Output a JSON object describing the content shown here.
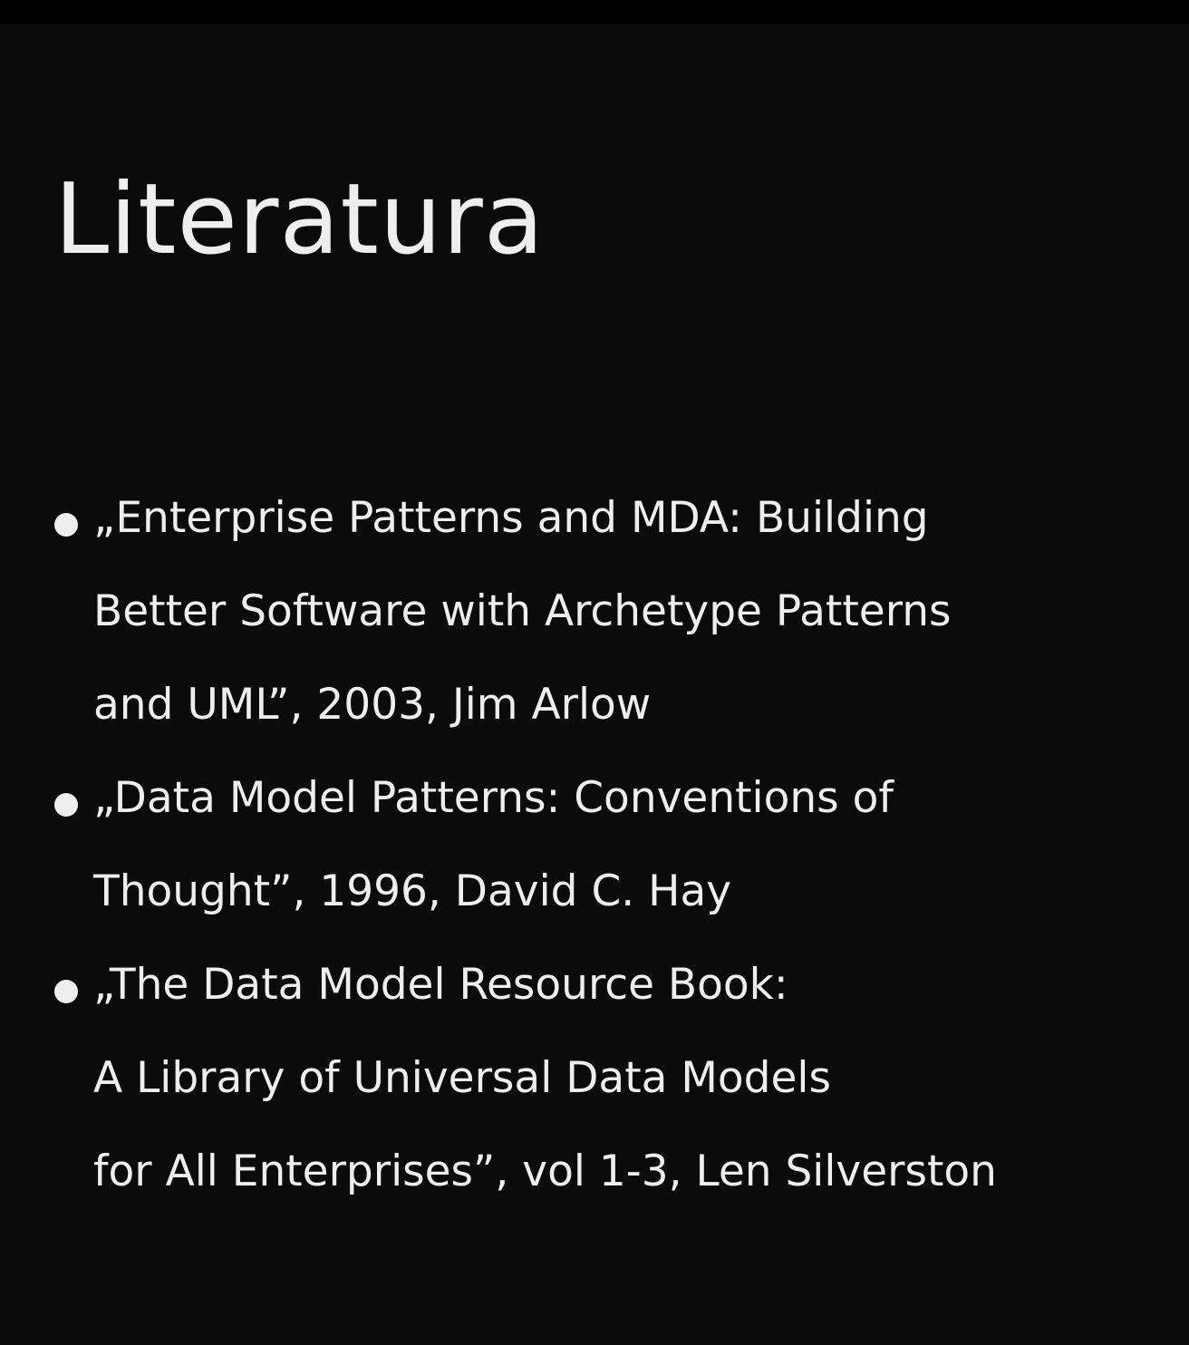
{
  "slide": {
    "title": "Literatura",
    "items": [
      {
        "lines": [
          "„Enterprise Patterns and MDA: Building",
          "Better Software with Archetype Patterns",
          "and UML”, 2003, Jim Arlow"
        ]
      },
      {
        "lines": [
          "„Data Model Patterns: Conventions of",
          "Thought”, 1996, David C. Hay"
        ]
      },
      {
        "lines": [
          "„The Data Model Resource Book:",
          "A Library of Universal Data Models",
          "for All Enterprises”, vol 1-3, Len Silverston"
        ]
      }
    ]
  },
  "colors": {
    "background": "#0b0b0b",
    "text": "#eeeeee"
  }
}
